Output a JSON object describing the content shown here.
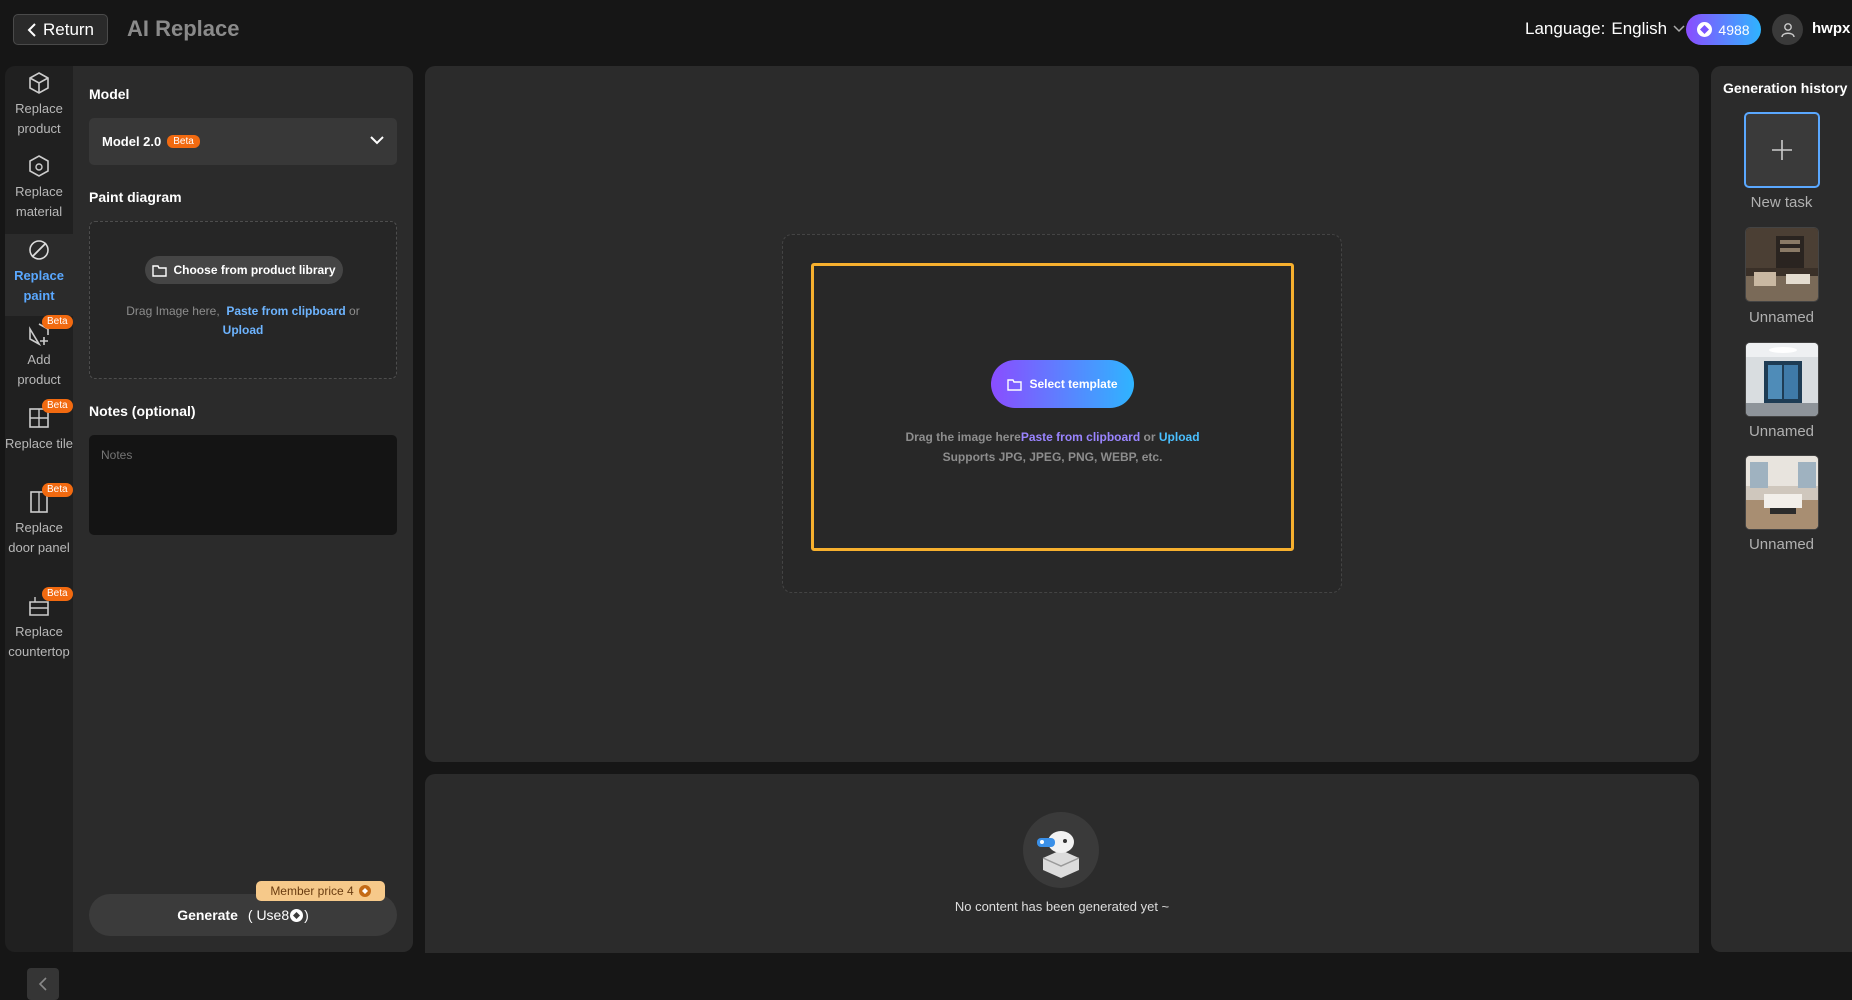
{
  "header": {
    "return_label": "Return",
    "app_title": "AI Replace",
    "language_label": "Language:",
    "language_value": "English",
    "points": "4988",
    "username": "hwpx"
  },
  "tools": [
    {
      "label": "Replace product",
      "beta": ""
    },
    {
      "label": "Replace material",
      "beta": ""
    },
    {
      "label": "Replace paint",
      "beta": ""
    },
    {
      "label": "Add product",
      "beta": "Beta"
    },
    {
      "label": "Replace tile",
      "beta": "Beta"
    },
    {
      "label": "Replace door panel",
      "beta": "Beta"
    },
    {
      "label": "Replace countertop",
      "beta": "Beta"
    }
  ],
  "settings": {
    "model_label": "Model",
    "model_value": "Model 2.0",
    "model_beta": "Beta",
    "paint_label": "Paint diagram",
    "choose_library": "Choose from product library",
    "drag_text": "Drag Image here,",
    "paste_link": "Paste from clipboard",
    "or_text": "or",
    "upload_link": "Upload",
    "notes_label": "Notes (optional)",
    "notes_placeholder": "Notes",
    "member_price": "Member price 4",
    "generate_label": "Generate",
    "generate_cost": "( Use8",
    "generate_close": ")"
  },
  "canvas": {
    "select_template": "Select template",
    "drag_text": "Drag the image here",
    "paste_link": "Paste from clipboard",
    "or_text": "or",
    "upload_link": "Upload",
    "supports": "Supports JPG, JPEG, PNG, WEBP, etc."
  },
  "output": {
    "empty_text": "No content has been generated yet ~"
  },
  "history": {
    "title": "Generation history",
    "new_task": "New task",
    "items": [
      {
        "label": "Unnamed"
      },
      {
        "label": "Unnamed"
      },
      {
        "label": "Unnamed"
      }
    ]
  },
  "colors": {
    "accent_blue": "#5aa8ff",
    "beta_orange": "#f26a10",
    "template_border": "#f7b02e",
    "gradient_start": "#8a4dff",
    "gradient_end": "#2fb4ff"
  }
}
